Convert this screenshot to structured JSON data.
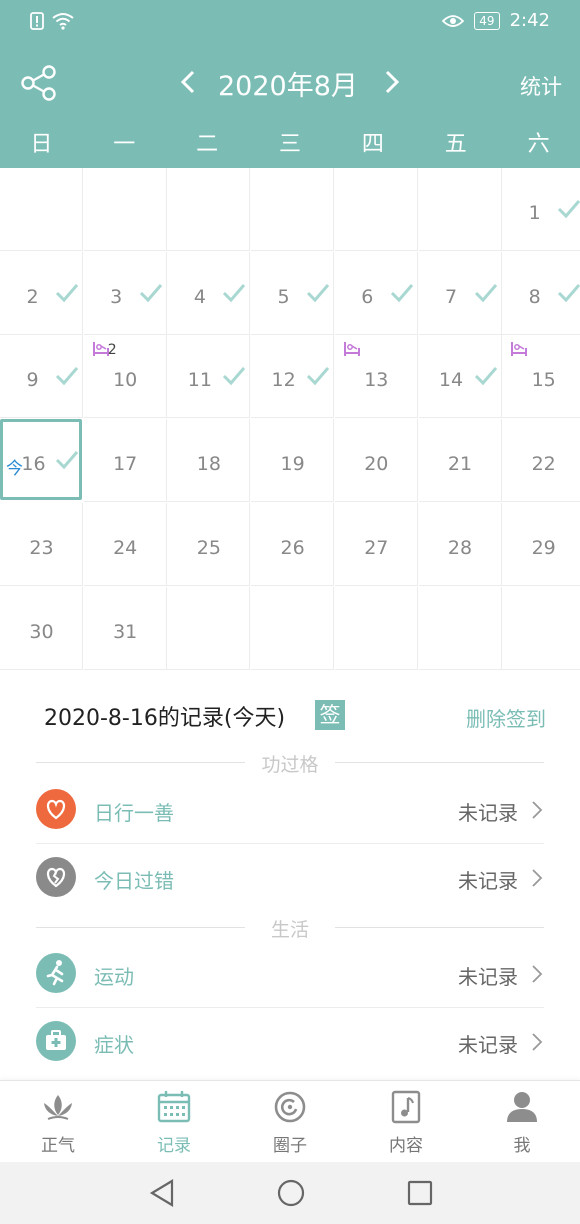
{
  "status_bar": {
    "battery": "49",
    "time": "2:42"
  },
  "header": {
    "month_title": "2020年8月",
    "stats_label": "统计"
  },
  "weekdays": [
    "日",
    "一",
    "二",
    "三",
    "四",
    "五",
    "六"
  ],
  "calendar": {
    "today_label": "今",
    "days": [
      {
        "day": "1",
        "done": true
      },
      {
        "day": "2",
        "done": true
      },
      {
        "day": "3",
        "done": true
      },
      {
        "day": "4",
        "done": true
      },
      {
        "day": "5",
        "done": true
      },
      {
        "day": "6",
        "done": true
      },
      {
        "day": "7",
        "done": true
      },
      {
        "day": "8",
        "done": true
      },
      {
        "day": "9",
        "done": true
      },
      {
        "day": "10",
        "done": false,
        "mark": true,
        "mark_count": "2"
      },
      {
        "day": "11",
        "done": true
      },
      {
        "day": "12",
        "done": true
      },
      {
        "day": "13",
        "done": false,
        "mark": true
      },
      {
        "day": "14",
        "done": true
      },
      {
        "day": "15",
        "done": false,
        "mark": true
      },
      {
        "day": "16",
        "done": true,
        "today": true
      },
      {
        "day": "17",
        "done": false
      },
      {
        "day": "18",
        "done": false
      },
      {
        "day": "19",
        "done": false
      },
      {
        "day": "20",
        "done": false
      },
      {
        "day": "21",
        "done": false
      },
      {
        "day": "22",
        "done": false
      },
      {
        "day": "23",
        "done": false
      },
      {
        "day": "24",
        "done": false
      },
      {
        "day": "25",
        "done": false
      },
      {
        "day": "26",
        "done": false
      },
      {
        "day": "27",
        "done": false
      },
      {
        "day": "28",
        "done": false
      },
      {
        "day": "29",
        "done": false
      },
      {
        "day": "30",
        "done": false
      },
      {
        "day": "31",
        "done": false
      }
    ]
  },
  "record": {
    "title": "2020-8-16的记录(今天)",
    "sign_badge": "签",
    "delete_sign": "删除签到",
    "section_merit": "功过格",
    "section_life": "生活",
    "items": [
      {
        "label": "日行一善",
        "value": "未记录",
        "icon": "heart-icon",
        "color": "#ee6a3e"
      },
      {
        "label": "今日过错",
        "value": "未记录",
        "icon": "broken-heart-icon",
        "color": "#8a8a8a"
      },
      {
        "label": "运动",
        "value": "未记录",
        "icon": "running-icon",
        "color": "#7bbdb5"
      },
      {
        "label": "症状",
        "value": "未记录",
        "icon": "medical-kit-icon",
        "color": "#7bbdb5"
      }
    ]
  },
  "bottom_nav": [
    {
      "label": "正气",
      "icon": "lotus-icon"
    },
    {
      "label": "记录",
      "icon": "calendar-icon",
      "active": true
    },
    {
      "label": "圈子",
      "icon": "circle-icon"
    },
    {
      "label": "内容",
      "icon": "music-note-icon"
    },
    {
      "label": "我",
      "icon": "person-icon"
    }
  ],
  "colors": {
    "accent": "#7bbdb5",
    "today_tag": "#2b8bd2",
    "heart": "#ee6a3e"
  }
}
